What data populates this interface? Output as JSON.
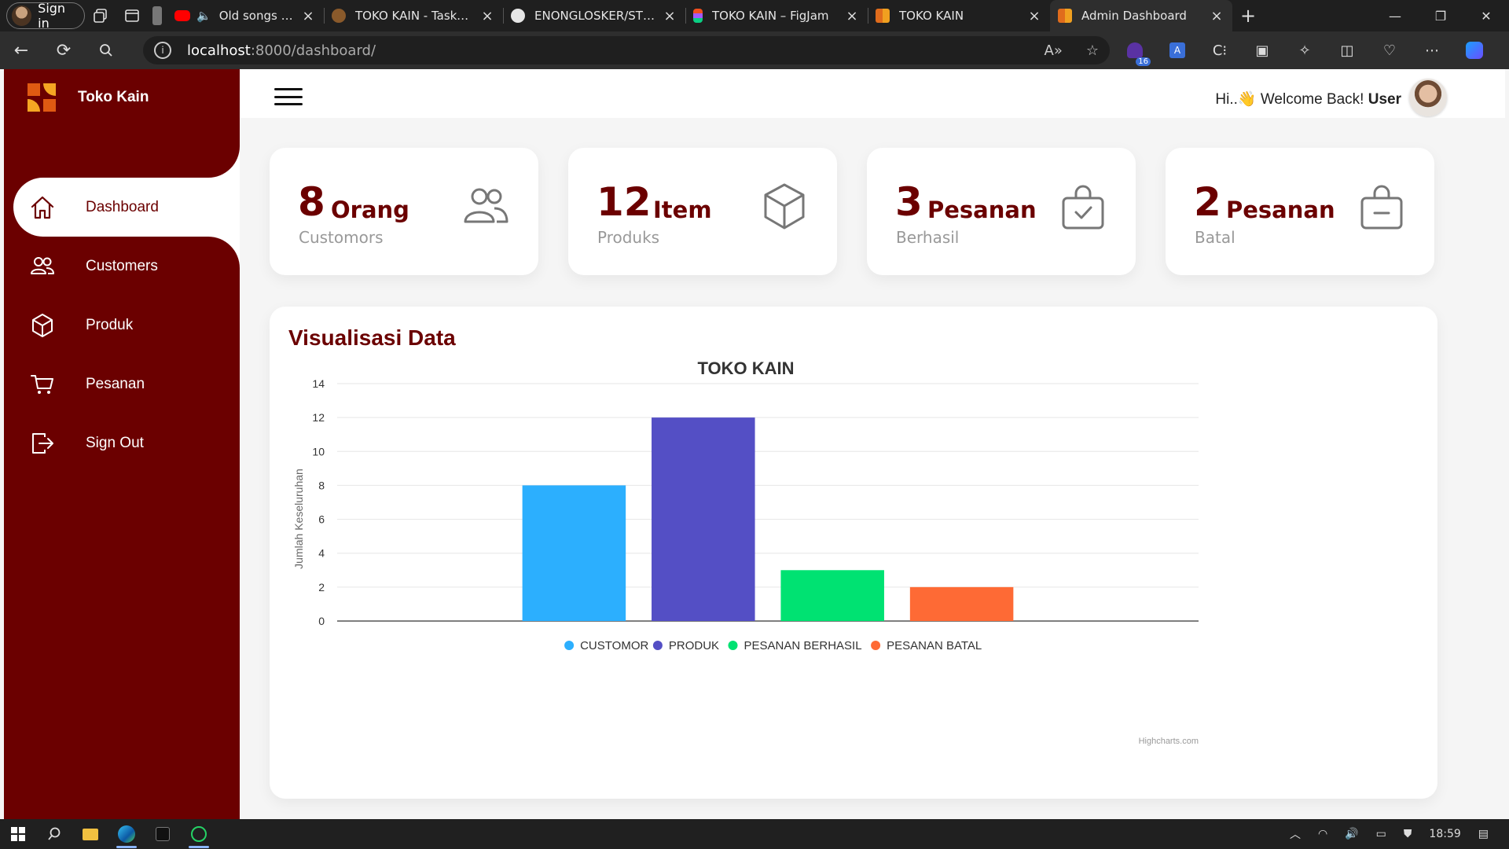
{
  "browser": {
    "profile_label": "Sign in",
    "tabs": [
      {
        "title": "Old songs but it's",
        "favicon_color": "#ff0000",
        "active": false
      },
      {
        "title": "TOKO KAIN - Taskade",
        "favicon_color": "#8a5a2b",
        "active": false
      },
      {
        "title": "ENONGLOSKER/STORE",
        "favicon_color": "#e6e6e6",
        "active": false
      },
      {
        "title": "TOKO KAIN – FigJam",
        "favicon_color": "#a259ff",
        "active": false
      },
      {
        "title": "TOKO KAIN",
        "favicon_color": "#e06c1c",
        "active": false
      },
      {
        "title": "Admin Dashboard",
        "favicon_color": "#e06c1c",
        "active": true
      }
    ],
    "url_host": "localhost",
    "url_path": ":8000/dashboard/",
    "extension_badge": "16"
  },
  "sidebar": {
    "brand": "Toko Kain",
    "items": [
      {
        "label": "Dashboard",
        "icon": "home-icon",
        "active": true
      },
      {
        "label": "Customers",
        "icon": "users-icon",
        "active": false
      },
      {
        "label": "Produk",
        "icon": "cube-icon",
        "active": false
      },
      {
        "label": "Pesanan",
        "icon": "cart-icon",
        "active": false
      },
      {
        "label": "Sign Out",
        "icon": "sign-out-icon",
        "active": false
      }
    ]
  },
  "header": {
    "greeting": "Hi..",
    "wave": "👋",
    "welcome": " Welcome Back! ",
    "user": "User"
  },
  "cards": [
    {
      "value": "8",
      "unit": "Orang",
      "label": "Customors",
      "icon": "users-icon"
    },
    {
      "value": "12",
      "unit": "Item",
      "label": "Produks",
      "icon": "cube-icon"
    },
    {
      "value": "3",
      "unit": "Pesanan",
      "label": "Berhasil",
      "icon": "bag-check-icon"
    },
    {
      "value": "2",
      "unit": "Pesanan",
      "label": "Batal",
      "icon": "bag-minus-icon"
    }
  ],
  "chart_section": {
    "heading": "Visualisasi Data",
    "credit": "Highcharts.com"
  },
  "chart_data": {
    "type": "bar",
    "title": "TOKO KAIN",
    "xlabel": "",
    "ylabel": "Jumlah Keseluruhan",
    "ylim": [
      0,
      14
    ],
    "yticks": [
      0,
      2,
      4,
      6,
      8,
      10,
      12,
      14
    ],
    "grid": true,
    "legend": "bottom-center",
    "series": [
      {
        "name": "CUSTOMOR",
        "values": [
          8
        ],
        "color": "#2caffe"
      },
      {
        "name": "PRODUK",
        "values": [
          12
        ],
        "color": "#544fc5"
      },
      {
        "name": "PESANAN BERHASIL",
        "values": [
          3
        ],
        "color": "#00e272"
      },
      {
        "name": "PESANAN BATAL",
        "values": [
          2
        ],
        "color": "#fe6a35"
      }
    ]
  },
  "taskbar": {
    "time": "18:59"
  }
}
